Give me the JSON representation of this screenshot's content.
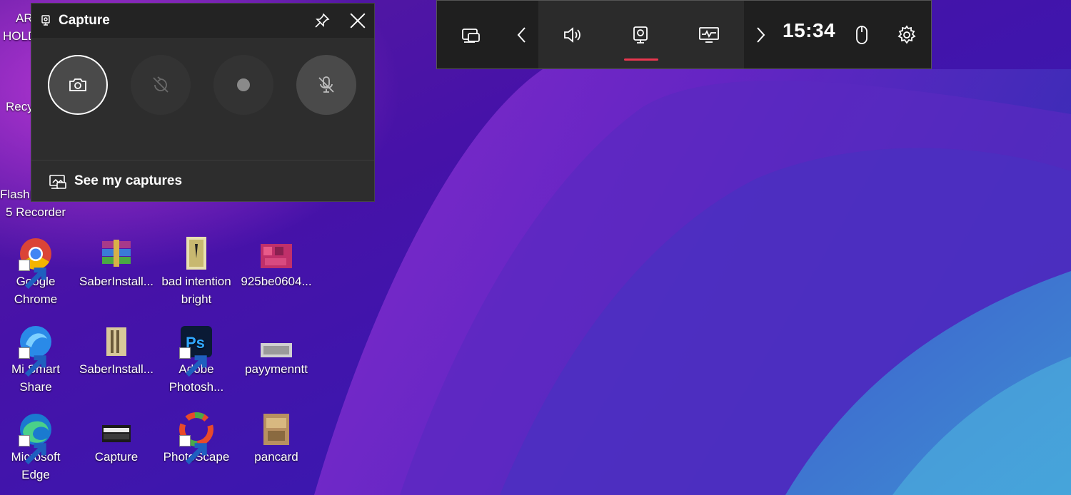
{
  "colors": {
    "accent": "#e8374f",
    "panel": "#2d2d2d",
    "bar": "#1f1f1f"
  },
  "desktop": {
    "partial_labels": [
      "AR",
      "HOLD",
      "Recy",
      "FlashB",
      "5 Recorder"
    ],
    "icons": [
      {
        "label1": "Google",
        "label2": "Chrome",
        "icon": "chrome-icon"
      },
      {
        "label1": "SaberInstall...",
        "label2": "",
        "icon": "winrar-icon"
      },
      {
        "label1": "bad intention",
        "label2": "bright",
        "icon": "image-icon"
      },
      {
        "label1": "925be0604...",
        "label2": "",
        "icon": "image-icon"
      },
      {
        "label1": "Mi Smart",
        "label2": "Share",
        "icon": "mi-smart-share-icon"
      },
      {
        "label1": "SaberInstall...",
        "label2": "",
        "icon": "archive-icon"
      },
      {
        "label1": "Adobe",
        "label2": "Photosh...",
        "icon": "photoshop-icon"
      },
      {
        "label1": "payymenntt",
        "label2": "",
        "icon": "image-icon"
      },
      {
        "label1": "Microsoft",
        "label2": "Edge",
        "icon": "edge-icon"
      },
      {
        "label1": "Capture",
        "label2": "",
        "icon": "capture-folder-icon"
      },
      {
        "label1": "PhotoScape",
        "label2": "",
        "icon": "photoscape-icon"
      },
      {
        "label1": "pancard",
        "label2": "",
        "icon": "image-icon"
      }
    ]
  },
  "gamebar": {
    "clock": "15:34",
    "items": [
      "widget-menu-icon",
      "chevron-left-icon",
      "audio-icon",
      "capture-icon",
      "performance-icon",
      "chevron-right-icon",
      "mouse-icon",
      "gear-icon"
    ],
    "active": "capture-icon"
  },
  "capture_widget": {
    "title": "Capture",
    "footer_label": "See my captures",
    "buttons": [
      "screenshot-button",
      "record-last-30s-button",
      "start-recording-button",
      "mic-toggle-button"
    ]
  }
}
